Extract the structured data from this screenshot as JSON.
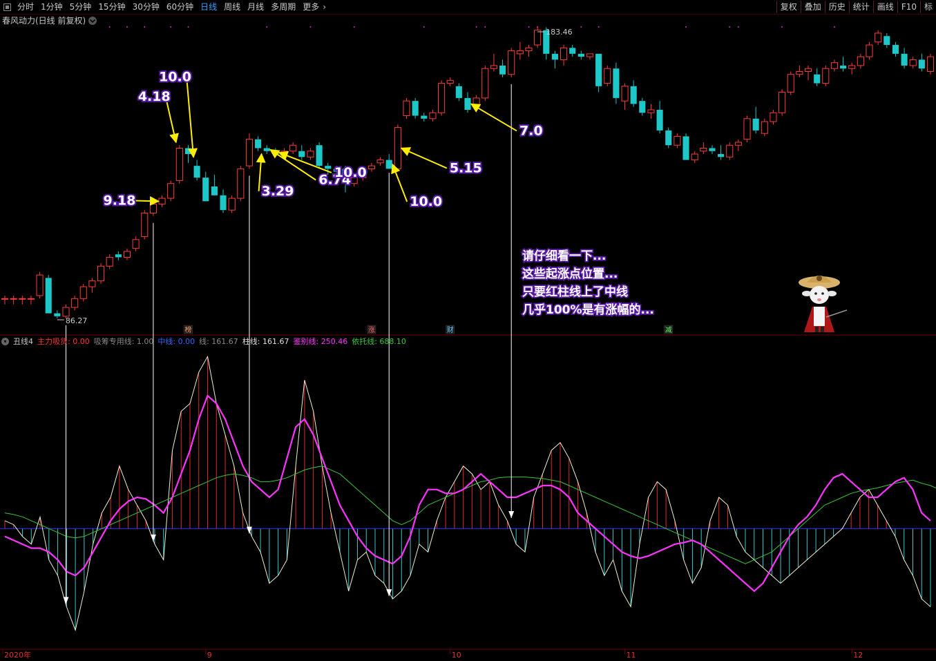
{
  "toolbar": {
    "periods": [
      "分时",
      "1分钟",
      "5分钟",
      "15分钟",
      "30分钟",
      "60分钟",
      "日线",
      "周线",
      "月线",
      "多周期",
      "更多"
    ],
    "active_period": "日线",
    "right_buttons": [
      "复权",
      "叠加",
      "历史",
      "统计",
      "画线",
      "F10",
      "标"
    ]
  },
  "main_panel": {
    "title": "春风动力(日线 前复权)",
    "high_label": "183.46",
    "low_label": "86.27"
  },
  "indicator_panel": {
    "name": "丑线4",
    "fields": [
      {
        "label": "主力吸货:",
        "value": "0.00",
        "color": "#ff3333"
      },
      {
        "label": "吸筹专用线:",
        "value": "1.00",
        "color": "#8a8a8a"
      },
      {
        "label": "中线:",
        "value": "0.00",
        "color": "#3366ff"
      },
      {
        "label": "线:",
        "value": "161.67",
        "color": "#8a8a8a"
      },
      {
        "label": "柱线:",
        "value": "161.67",
        "color": "#e0e0e0"
      },
      {
        "label": "鉴别线:",
        "value": "250.46",
        "color": "#ff33ff"
      },
      {
        "label": "依托线:",
        "value": "688.10",
        "color": "#33cc33"
      }
    ]
  },
  "event_markers": [
    {
      "text": "榜",
      "color": "#ff9966"
    },
    {
      "text": "涨",
      "color": "#ff6666"
    },
    {
      "text": "财",
      "color": "#66ccff"
    },
    {
      "text": "减",
      "color": "#66ff66"
    }
  ],
  "annotation_note": [
    "请仔细看一下...",
    "这些起涨点位置...",
    "只要红柱线上了中线",
    "几乎100%是有涨幅的..."
  ],
  "x_axis_labels": [
    "2020年",
    "9",
    "10",
    "11",
    "12"
  ],
  "chart_data": {
    "type": "candlestick",
    "candles": [
      [
        93,
        94,
        91,
        93
      ],
      [
        93,
        94,
        91,
        93
      ],
      [
        93,
        94,
        91,
        93
      ],
      [
        93,
        94,
        91,
        93
      ],
      [
        94,
        102,
        93,
        101
      ],
      [
        100,
        101,
        88,
        88
      ],
      [
        88,
        89,
        86.3,
        87
      ],
      [
        87,
        91,
        86.3,
        90
      ],
      [
        90,
        94,
        89,
        93
      ],
      [
        93,
        98,
        92,
        97
      ],
      [
        97,
        100,
        95,
        99
      ],
      [
        99,
        105,
        98,
        104
      ],
      [
        104,
        108,
        103,
        107
      ],
      [
        108,
        109,
        106,
        107
      ],
      [
        107,
        110,
        106,
        109
      ],
      [
        110,
        114,
        109,
        113
      ],
      [
        114,
        123,
        113,
        122
      ],
      [
        122,
        126,
        121,
        125
      ],
      [
        125,
        128,
        124,
        127
      ],
      [
        127,
        133,
        126,
        132
      ],
      [
        133,
        145,
        132,
        144
      ],
      [
        144,
        145,
        139,
        142
      ],
      [
        138,
        140,
        133,
        134
      ],
      [
        134,
        136,
        126,
        126
      ],
      [
        131,
        135,
        128,
        128
      ],
      [
        128,
        130,
        122,
        123
      ],
      [
        123,
        128,
        122,
        127
      ],
      [
        127,
        138,
        126,
        137
      ],
      [
        138,
        149,
        137,
        147
      ],
      [
        147,
        148,
        143,
        144
      ],
      [
        144,
        145,
        142,
        143
      ],
      [
        143,
        144,
        141,
        142
      ],
      [
        142,
        144,
        140,
        143
      ],
      [
        143,
        146,
        142,
        145
      ],
      [
        143,
        145,
        140,
        141
      ],
      [
        141,
        144,
        140,
        143
      ],
      [
        145,
        146,
        137,
        138
      ],
      [
        138,
        139,
        135,
        137
      ],
      [
        137,
        138,
        135,
        136
      ],
      [
        137,
        138,
        129,
        132
      ],
      [
        132,
        135,
        131,
        134
      ],
      [
        134,
        137,
        133,
        136
      ],
      [
        137,
        139,
        136,
        138
      ],
      [
        139,
        141,
        138,
        140
      ],
      [
        140,
        142,
        138,
        137
      ],
      [
        137,
        152,
        136,
        151
      ],
      [
        155,
        161,
        154,
        160
      ],
      [
        160,
        161,
        154,
        155
      ],
      [
        155,
        156,
        153,
        154
      ],
      [
        154,
        157,
        153,
        156
      ],
      [
        156,
        167,
        155,
        166
      ],
      [
        166,
        168,
        165,
        167
      ],
      [
        165,
        166,
        160,
        161
      ],
      [
        161,
        163,
        156,
        157
      ],
      [
        158,
        162,
        157,
        161
      ],
      [
        161,
        172,
        160,
        171
      ],
      [
        171,
        176,
        170,
        172
      ],
      [
        172,
        174,
        168,
        169
      ],
      [
        169,
        178,
        168,
        177
      ],
      [
        176,
        180,
        174,
        177
      ],
      [
        177,
        179,
        175,
        178
      ],
      [
        179,
        185,
        178,
        184
      ],
      [
        184,
        185,
        174,
        176
      ],
      [
        176,
        177,
        171,
        174
      ],
      [
        174,
        179,
        172,
        178
      ],
      [
        178,
        179,
        175,
        176
      ],
      [
        176,
        177,
        174,
        175
      ],
      [
        175,
        176,
        174,
        176
      ],
      [
        176,
        176,
        163,
        165
      ],
      [
        166,
        172,
        165,
        171
      ],
      [
        171,
        173,
        159,
        161
      ],
      [
        160,
        166,
        157,
        165
      ],
      [
        165,
        167,
        158,
        159
      ],
      [
        160,
        161,
        155,
        156
      ],
      [
        156,
        159,
        154,
        157
      ],
      [
        157,
        160,
        149,
        150
      ],
      [
        150,
        151,
        144,
        145
      ],
      [
        145,
        149,
        144,
        148
      ],
      [
        148,
        149,
        140,
        140
      ],
      [
        140,
        143,
        139,
        142
      ],
      [
        143,
        146,
        142,
        144
      ],
      [
        144,
        145,
        142,
        143
      ],
      [
        142,
        145,
        140,
        141
      ],
      [
        141,
        146,
        140,
        145
      ],
      [
        145,
        147,
        143,
        146
      ],
      [
        147,
        155,
        146,
        154
      ],
      [
        154,
        158,
        149,
        150
      ],
      [
        149,
        154,
        148,
        153
      ],
      [
        153,
        157,
        152,
        156
      ],
      [
        156,
        164,
        155,
        163
      ],
      [
        163,
        170,
        162,
        169
      ],
      [
        169,
        172,
        168,
        170
      ],
      [
        170,
        172,
        167,
        171
      ],
      [
        169,
        171,
        165,
        166
      ],
      [
        166,
        172,
        165,
        171
      ],
      [
        171,
        174,
        170,
        173
      ],
      [
        172,
        175,
        170,
        171
      ],
      [
        171,
        173,
        169,
        172
      ],
      [
        172,
        176,
        171,
        175
      ],
      [
        175,
        180,
        174,
        179
      ],
      [
        180,
        184,
        179,
        183
      ],
      [
        182,
        183,
        178,
        179
      ],
      [
        179,
        180,
        175,
        176
      ],
      [
        176,
        178,
        171,
        172
      ],
      [
        172,
        175,
        171,
        174
      ],
      [
        174,
        176,
        170,
        171
      ],
      [
        170,
        176,
        169,
        175
      ]
    ],
    "high": 183.46,
    "low": 86.27,
    "ref_levels": [
      88.0,
      121.7
    ],
    "arrow_labels": [
      {
        "label": "9.18",
        "candle": 18
      },
      {
        "label": "4.18",
        "candle": 20
      },
      {
        "label": "10.0",
        "candle": 22
      },
      {
        "label": "3.29",
        "candle": 29
      },
      {
        "label": "6.74",
        "candle": 30
      },
      {
        "label": "10.0",
        "candle": 31
      },
      {
        "label": "10.0",
        "candle": 44
      },
      {
        "label": "5.15",
        "candle": 45
      },
      {
        "label": "7.0",
        "candle": 53
      }
    ],
    "indicator": {
      "range": [
        -150,
        230
      ],
      "zero_line": 0,
      "bars": [
        10,
        5,
        -10,
        -20,
        15,
        -40,
        -60,
        -100,
        -130,
        -80,
        -20,
        20,
        40,
        80,
        50,
        30,
        10,
        -20,
        -40,
        100,
        150,
        160,
        200,
        220,
        160,
        120,
        80,
        20,
        -10,
        -30,
        -70,
        -60,
        -40,
        80,
        190,
        150,
        80,
        20,
        -30,
        -80,
        -40,
        -30,
        -60,
        -70,
        -90,
        -80,
        -60,
        -20,
        -30,
        10,
        40,
        60,
        80,
        70,
        50,
        60,
        30,
        10,
        -20,
        -30,
        40,
        70,
        100,
        110,
        90,
        60,
        20,
        -30,
        -60,
        -40,
        -80,
        -100,
        -20,
        40,
        60,
        50,
        10,
        -40,
        -70,
        -50,
        10,
        40,
        30,
        -10,
        -30,
        -40,
        -50,
        -60,
        -70,
        -60,
        -50,
        -40,
        -30,
        -20,
        -10,
        0,
        20,
        40,
        50,
        30,
        10,
        -10,
        -40,
        -60,
        -90,
        -100
      ],
      "magenta": [
        -10,
        -15,
        -20,
        -25,
        -25,
        -30,
        -40,
        -55,
        -60,
        -50,
        -30,
        -10,
        10,
        25,
        35,
        40,
        38,
        30,
        20,
        40,
        70,
        100,
        140,
        170,
        160,
        140,
        110,
        80,
        60,
        50,
        40,
        50,
        90,
        130,
        140,
        120,
        90,
        60,
        30,
        10,
        -10,
        -25,
        -35,
        -40,
        -45,
        -35,
        -10,
        30,
        50,
        50,
        45,
        45,
        50,
        60,
        70,
        60,
        50,
        40,
        40,
        45,
        50,
        55,
        55,
        50,
        40,
        20,
        10,
        0,
        -10,
        -20,
        -30,
        -35,
        -38,
        -35,
        -30,
        -25,
        -20,
        -18,
        -15,
        -20,
        -30,
        -40,
        -50,
        -60,
        -70,
        -80,
        -70,
        -50,
        -30,
        -10,
        5,
        15,
        30,
        50,
        65,
        70,
        60,
        50,
        40,
        40,
        50,
        60,
        65,
        50,
        20,
        10
      ],
      "green": [
        20,
        18,
        15,
        10,
        5,
        0,
        -5,
        -10,
        -12,
        -10,
        -5,
        0,
        5,
        10,
        15,
        20,
        25,
        30,
        35,
        40,
        45,
        50,
        55,
        60,
        65,
        68,
        70,
        68,
        65,
        60,
        60,
        62,
        65,
        70,
        75,
        78,
        80,
        75,
        70,
        60,
        50,
        40,
        30,
        20,
        10,
        5,
        10,
        20,
        30,
        35,
        40,
        45,
        50,
        55,
        60,
        62,
        65,
        66,
        66,
        66,
        65,
        64,
        62,
        60,
        55,
        50,
        45,
        40,
        35,
        30,
        25,
        20,
        15,
        10,
        5,
        0,
        -5,
        -10,
        -15,
        -20,
        -25,
        -30,
        -35,
        -40,
        -45,
        -40,
        -35,
        -30,
        -20,
        -10,
        0,
        10,
        20,
        30,
        35,
        40,
        45,
        48,
        50,
        52,
        55,
        58,
        60,
        62,
        58,
        55,
        50
      ],
      "vertical_markers": [
        7,
        17,
        28,
        44,
        58
      ]
    }
  }
}
